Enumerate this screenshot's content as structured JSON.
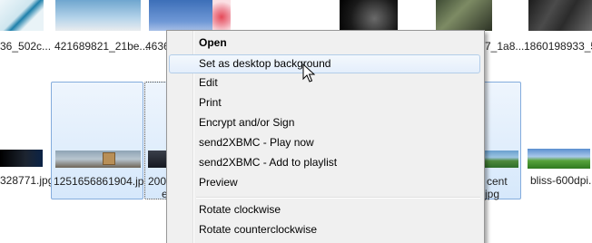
{
  "top_row": [
    {
      "label": "36_502c..."
    },
    {
      "label": "421689821_21be..."
    },
    {
      "label": "4636"
    },
    {
      "label": "7_1a8..."
    },
    {
      "label": "1860198933_5c..."
    }
  ],
  "bottom_row": [
    {
      "label": "328771.jpg"
    },
    {
      "label": "1251656861904.jpg"
    },
    {
      "label_line1": "2008",
      "label_line2": "e"
    },
    {
      "label_line1": "cent",
      "label_line2": "jpg"
    },
    {
      "label": "bliss-600dpi."
    }
  ],
  "context_menu": {
    "items": [
      {
        "label": "Open"
      },
      {
        "label": "Set as desktop background"
      },
      {
        "label": "Edit"
      },
      {
        "label": "Print"
      },
      {
        "label": "Encrypt and/or Sign"
      },
      {
        "label": "send2XBMC - Play now"
      },
      {
        "label": "send2XBMC - Add to playlist"
      },
      {
        "label": "Preview"
      },
      {
        "label": "Rotate clockwise"
      },
      {
        "label": "Rotate counterclockwise"
      }
    ]
  },
  "colors": {
    "selection_fill": "#d6e8fb",
    "selection_border": "#84acdd",
    "menu_background": "#f0f0f0"
  }
}
